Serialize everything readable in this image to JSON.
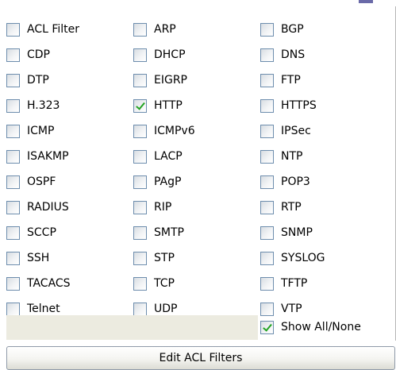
{
  "filters": [
    {
      "label": "ACL Filter",
      "checked": false
    },
    {
      "label": "ARP",
      "checked": false
    },
    {
      "label": "BGP",
      "checked": false
    },
    {
      "label": "CDP",
      "checked": false
    },
    {
      "label": "DHCP",
      "checked": false
    },
    {
      "label": "DNS",
      "checked": false
    },
    {
      "label": "DTP",
      "checked": false
    },
    {
      "label": "EIGRP",
      "checked": false
    },
    {
      "label": "FTP",
      "checked": false
    },
    {
      "label": "H.323",
      "checked": false
    },
    {
      "label": "HTTP",
      "checked": true
    },
    {
      "label": "HTTPS",
      "checked": false
    },
    {
      "label": "ICMP",
      "checked": false
    },
    {
      "label": "ICMPv6",
      "checked": false
    },
    {
      "label": "IPSec",
      "checked": false
    },
    {
      "label": "ISAKMP",
      "checked": false
    },
    {
      "label": "LACP",
      "checked": false
    },
    {
      "label": "NTP",
      "checked": false
    },
    {
      "label": "OSPF",
      "checked": false
    },
    {
      "label": "PAgP",
      "checked": false
    },
    {
      "label": "POP3",
      "checked": false
    },
    {
      "label": "RADIUS",
      "checked": false
    },
    {
      "label": "RIP",
      "checked": false
    },
    {
      "label": "RTP",
      "checked": false
    },
    {
      "label": "SCCP",
      "checked": false
    },
    {
      "label": "SMTP",
      "checked": false
    },
    {
      "label": "SNMP",
      "checked": false
    },
    {
      "label": "SSH",
      "checked": false
    },
    {
      "label": "STP",
      "checked": false
    },
    {
      "label": "SYSLOG",
      "checked": false
    },
    {
      "label": "TACACS",
      "checked": false
    },
    {
      "label": "TCP",
      "checked": false
    },
    {
      "label": "TFTP",
      "checked": false
    },
    {
      "label": "Telnet",
      "checked": false
    },
    {
      "label": "UDP",
      "checked": false
    },
    {
      "label": "VTP",
      "checked": false
    }
  ],
  "show_all": {
    "label": "Show All/None",
    "checked": true
  },
  "edit_button": {
    "label": "Edit ACL Filters"
  },
  "colors": {
    "check": "#23a323",
    "box_border": "#6d8dad",
    "filler": "#ecebe0"
  }
}
